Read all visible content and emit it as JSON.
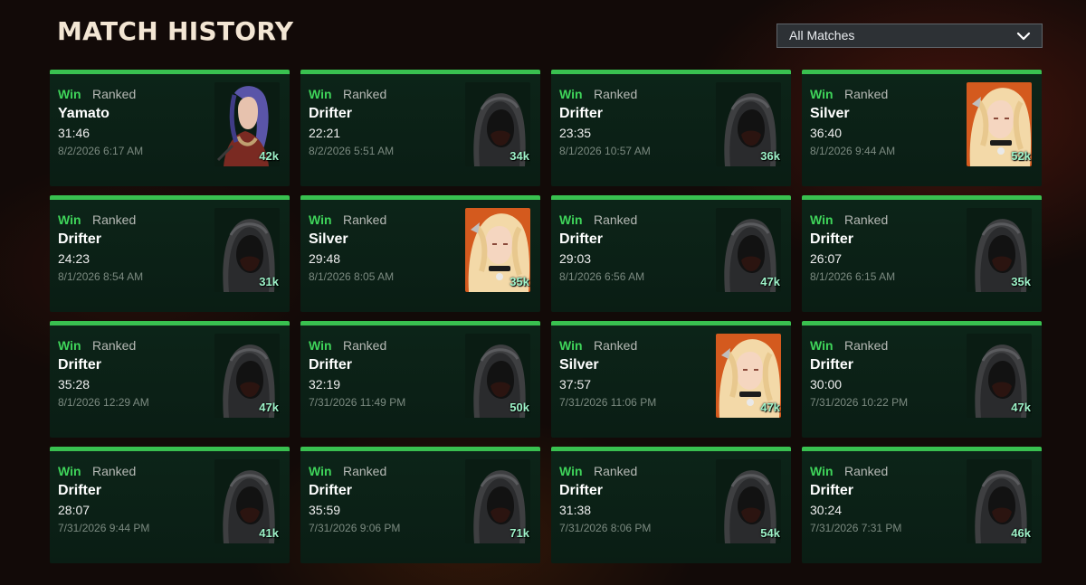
{
  "header": {
    "title": "MATCH HISTORY"
  },
  "filter": {
    "selected": "All Matches",
    "icon": "chevron-down-icon"
  },
  "colors": {
    "win": "#3fd45a",
    "card_top_border": "#39c050",
    "damage": "#9df2c8"
  },
  "matches": [
    {
      "result": "Win",
      "mode": "Ranked",
      "hero": "Yamato",
      "duration": "31:46",
      "date": "8/2/2026 6:17 AM",
      "damage": "42k",
      "portrait": "yamato-portrait"
    },
    {
      "result": "Win",
      "mode": "Ranked",
      "hero": "Drifter",
      "duration": "22:21",
      "date": "8/2/2026 5:51 AM",
      "damage": "34k",
      "portrait": "drifter-portrait"
    },
    {
      "result": "Win",
      "mode": "Ranked",
      "hero": "Drifter",
      "duration": "23:35",
      "date": "8/1/2026 10:57 AM",
      "damage": "36k",
      "portrait": "drifter-portrait"
    },
    {
      "result": "Win",
      "mode": "Ranked",
      "hero": "Silver",
      "duration": "36:40",
      "date": "8/1/2026 9:44 AM",
      "damage": "52k",
      "portrait": "silver-portrait"
    },
    {
      "result": "Win",
      "mode": "Ranked",
      "hero": "Drifter",
      "duration": "24:23",
      "date": "8/1/2026 8:54 AM",
      "damage": "31k",
      "portrait": "drifter-portrait"
    },
    {
      "result": "Win",
      "mode": "Ranked",
      "hero": "Silver",
      "duration": "29:48",
      "date": "8/1/2026 8:05 AM",
      "damage": "35k",
      "portrait": "silver-portrait"
    },
    {
      "result": "Win",
      "mode": "Ranked",
      "hero": "Drifter",
      "duration": "29:03",
      "date": "8/1/2026 6:56 AM",
      "damage": "47k",
      "portrait": "drifter-portrait"
    },
    {
      "result": "Win",
      "mode": "Ranked",
      "hero": "Drifter",
      "duration": "26:07",
      "date": "8/1/2026 6:15 AM",
      "damage": "35k",
      "portrait": "drifter-portrait"
    },
    {
      "result": "Win",
      "mode": "Ranked",
      "hero": "Drifter",
      "duration": "35:28",
      "date": "8/1/2026 12:29 AM",
      "damage": "47k",
      "portrait": "drifter-portrait"
    },
    {
      "result": "Win",
      "mode": "Ranked",
      "hero": "Drifter",
      "duration": "32:19",
      "date": "7/31/2026 11:49 PM",
      "damage": "50k",
      "portrait": "drifter-portrait"
    },
    {
      "result": "Win",
      "mode": "Ranked",
      "hero": "Silver",
      "duration": "37:57",
      "date": "7/31/2026 11:06 PM",
      "damage": "47k",
      "portrait": "silver-portrait"
    },
    {
      "result": "Win",
      "mode": "Ranked",
      "hero": "Drifter",
      "duration": "30:00",
      "date": "7/31/2026 10:22 PM",
      "damage": "47k",
      "portrait": "drifter-portrait"
    },
    {
      "result": "Win",
      "mode": "Ranked",
      "hero": "Drifter",
      "duration": "28:07",
      "date": "7/31/2026 9:44 PM",
      "damage": "41k",
      "portrait": "drifter-portrait"
    },
    {
      "result": "Win",
      "mode": "Ranked",
      "hero": "Drifter",
      "duration": "35:59",
      "date": "7/31/2026 9:06 PM",
      "damage": "71k",
      "portrait": "drifter-portrait"
    },
    {
      "result": "Win",
      "mode": "Ranked",
      "hero": "Drifter",
      "duration": "31:38",
      "date": "7/31/2026 8:06 PM",
      "damage": "54k",
      "portrait": "drifter-portrait"
    },
    {
      "result": "Win",
      "mode": "Ranked",
      "hero": "Drifter",
      "duration": "30:24",
      "date": "7/31/2026 7:31 PM",
      "damage": "46k",
      "portrait": "drifter-portrait"
    }
  ]
}
